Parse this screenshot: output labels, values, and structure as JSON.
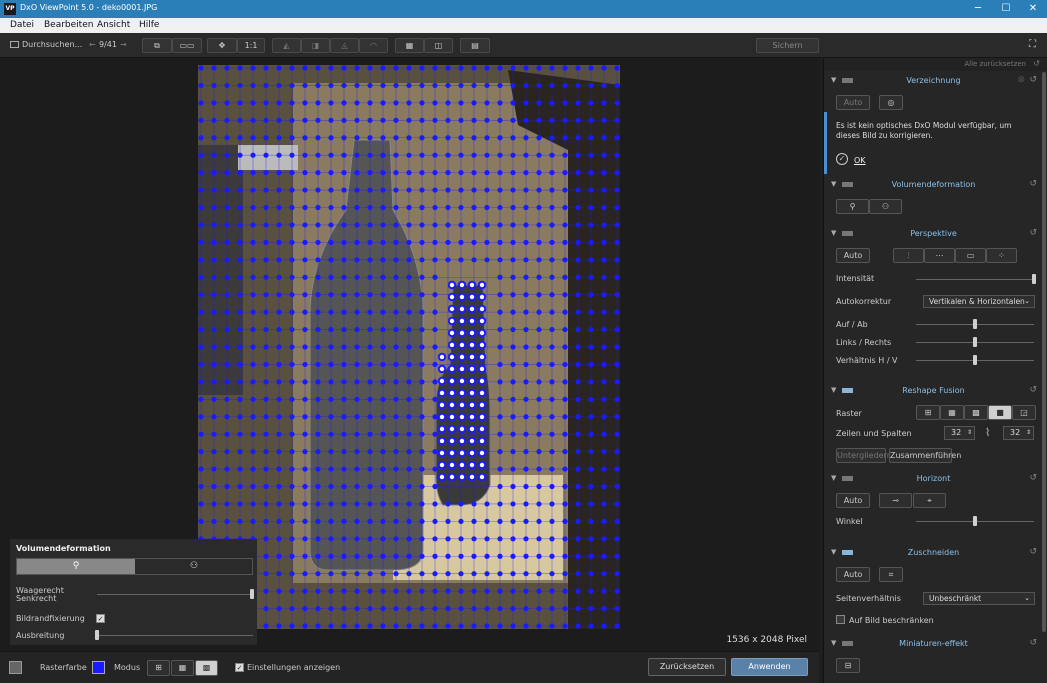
{
  "window": {
    "app_icon": "VP",
    "title": "DxO ViewPoint 5.0 - deko0001.JPG",
    "minimize": "─",
    "maximize": "☐",
    "close": "✕"
  },
  "menu": {
    "items": [
      "Datei",
      "Bearbeiten",
      "Ansicht",
      "Hilfe"
    ]
  },
  "toolbar": {
    "browse_label": "Durchsuchen...",
    "counter": "9/41",
    "zoom_1to1": "1:1",
    "save_label": "Sichern"
  },
  "viewer": {
    "pixel_info": "1536 x 2048 Pixel",
    "grid_color": "#1a1aff"
  },
  "float_panel": {
    "title": "Volumendeformation",
    "horizontal_label": "Waagerecht",
    "vertical_label": "Senkrecht",
    "horizontal_value": 1.0,
    "edge_fix_label": "Bildrandfixierung",
    "edge_fix_checked": true,
    "spread_label": "Ausbreitung",
    "spread_value": 0.0
  },
  "bottombar": {
    "gridcolor_label": "Rasterfarbe",
    "mode_label": "Modus",
    "show_settings_label": "Einstellungen anzeigen",
    "show_settings_checked": true,
    "reset_label": "Zurücksetzen",
    "apply_label": "Anwenden"
  },
  "panel": {
    "reset_all": "Alle zurücksetzen",
    "distortion": {
      "name": "Verzeichnung",
      "auto_label": "Auto",
      "message": "Es ist kein optisches DxO Modul verfügbar, um dieses Bild zu korrigieren.",
      "ok_label": "OK"
    },
    "volume": {
      "name": "Volumendeformation"
    },
    "perspective": {
      "name": "Perspektive",
      "auto_label": "Auto",
      "intensity_label": "Intensität",
      "intensity_value": 1.0,
      "autocorrect_label": "Autokorrektur",
      "autocorrect_value": "Vertikalen & Horizontalen",
      "updown_label": "Auf / Ab",
      "updown_value": 0.5,
      "leftright_label": "Links / Rechts",
      "leftright_value": 0.5,
      "ratio_label": "Verhältnis H / V",
      "ratio_value": 0.5
    },
    "reshape": {
      "name": "Reshape Fusion",
      "grid_label": "Raster",
      "rowscols_label": "Zeilen und Spalten",
      "rows": "32",
      "cols": "32",
      "split_label": "Untergliedern",
      "merge_label": "Zusammenführen"
    },
    "horizon": {
      "name": "Horizont",
      "auto_label": "Auto",
      "angle_label": "Winkel",
      "angle_value": 0.5
    },
    "crop": {
      "name": "Zuschneiden",
      "auto_label": "Auto",
      "aspect_label": "Seitenverhältnis",
      "aspect_value": "Unbeschränkt",
      "restrict_label": "Auf Bild beschränken",
      "restrict_checked": false
    },
    "miniature": {
      "name": "Miniaturen-effekt"
    }
  }
}
